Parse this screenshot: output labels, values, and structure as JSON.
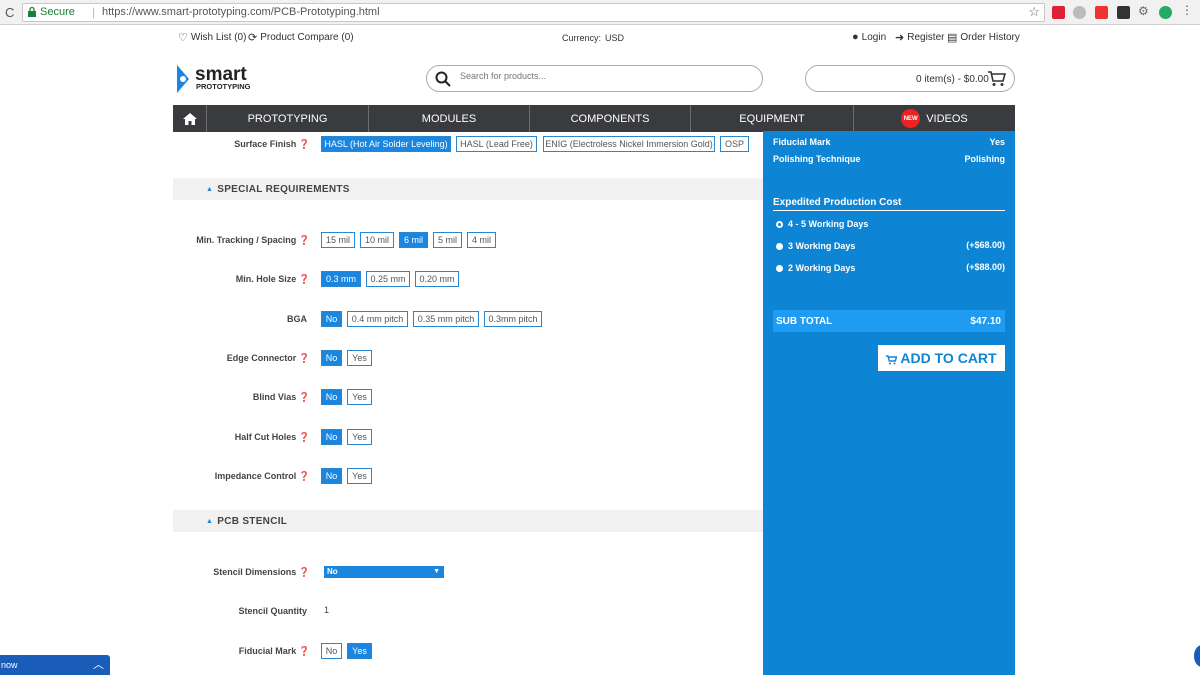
{
  "browser": {
    "secure_label": "Secure",
    "url": "https://www.smart-prototyping.com/PCB-Prototyping.html"
  },
  "topbar": {
    "wishlist": "Wish List (0)",
    "compare": "Product Compare (0)",
    "currency_label": "Currency:",
    "currency_value": "USD",
    "login": "Login",
    "register": "Register",
    "order_history": "Order History"
  },
  "header": {
    "logo_main": "smart",
    "logo_sub": "PROTOTYPING",
    "search_placeholder": "Search for products...",
    "cart_text": "0 item(s) - $0.00"
  },
  "nav": {
    "items": [
      "PROTOTYPING",
      "MODULES",
      "COMPONENTS",
      "EQUIPMENT",
      "VIDEOS"
    ],
    "new_badge": "NEW"
  },
  "form": {
    "surface_finish": {
      "label": "Surface Finish",
      "options": [
        "HASL (Hot Air Solder Leveling)",
        "HASL (Lead Free)",
        "ENIG (Electroless Nickel Immersion Gold)",
        "OSP"
      ],
      "selected": 0
    },
    "special_requirements_title": "SPECIAL REQUIREMENTS",
    "min_tracking": {
      "label": "Min. Tracking / Spacing",
      "options": [
        "15 mil",
        "10 mil",
        "6 mil",
        "5 mil",
        "4 mil"
      ],
      "selected": 2
    },
    "min_hole": {
      "label": "Min. Hole Size",
      "options": [
        "0.3 mm",
        "0.25 mm",
        "0.20 mm"
      ],
      "selected": 0
    },
    "bga": {
      "label": "BGA",
      "options": [
        "No",
        "0.4 mm pitch",
        "0.35 mm pitch",
        "0.3mm pitch"
      ],
      "selected": 0
    },
    "edge_connector": {
      "label": "Edge Connector",
      "options": [
        "No",
        "Yes"
      ],
      "selected": 0
    },
    "blind_vias": {
      "label": "Blind Vias",
      "options": [
        "No",
        "Yes"
      ],
      "selected": 0
    },
    "half_cut": {
      "label": "Half Cut Holes",
      "options": [
        "No",
        "Yes"
      ],
      "selected": 0
    },
    "impedance": {
      "label": "Impedance Control",
      "options": [
        "No",
        "Yes"
      ],
      "selected": 0
    },
    "pcb_stencil_title": "PCB STENCIL",
    "stencil_dimensions": {
      "label": "Stencil Dimensions",
      "value": "No"
    },
    "stencil_quantity": {
      "label": "Stencil Quantity",
      "value": "1"
    },
    "fiducial": {
      "label": "Fiducial Mark",
      "options": [
        "No",
        "Yes"
      ],
      "selected": 1
    }
  },
  "summary": {
    "fiducial_label": "Fiducial Mark",
    "fiducial_value": "Yes",
    "polishing_label": "Polishing Technique",
    "polishing_value": "Polishing",
    "expedited_title": "Expedited Production Cost",
    "options": [
      {
        "label": "4 - 5 Working Days",
        "price": ""
      },
      {
        "label": "3 Working Days",
        "price": "(+$68.00)"
      },
      {
        "label": "2 Working Days",
        "price": "(+$88.00)"
      }
    ],
    "selected": 0,
    "subtotal_label": "SUB TOTAL",
    "subtotal_value": "$47.10",
    "add_to_cart": "ADD TO CART"
  },
  "widget": {
    "label": "now"
  },
  "colors": {
    "accent": "#1a86e0",
    "panel": "#0e85d4",
    "nav": "#3a3b3f"
  }
}
